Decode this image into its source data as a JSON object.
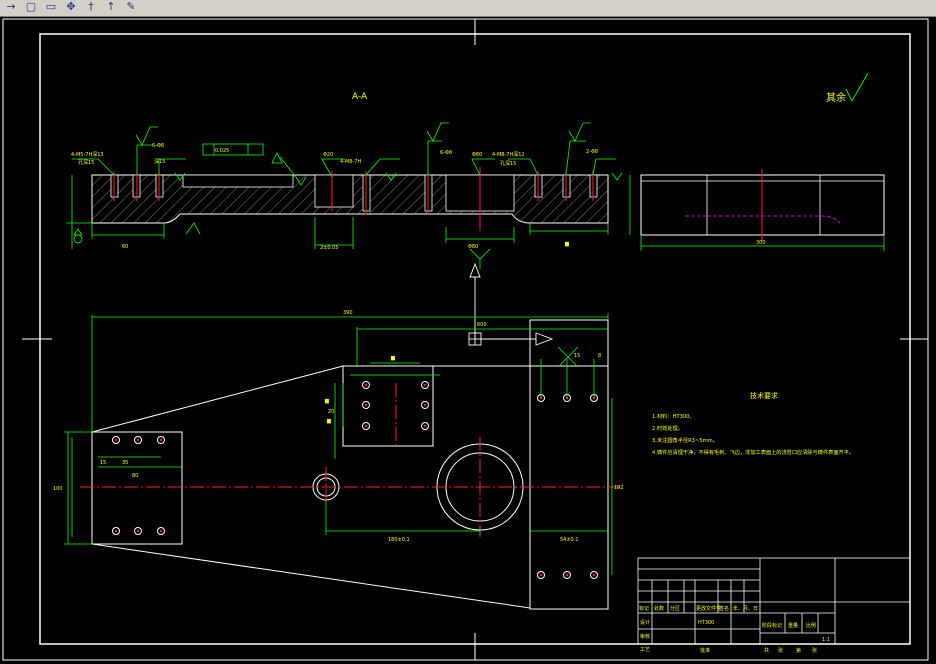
{
  "toolbar": {
    "tools": [
      {
        "name": "line-arrow-icon",
        "glyph": "→"
      },
      {
        "name": "rectangle-icon",
        "glyph": "▢"
      },
      {
        "name": "rectangle-alt-icon",
        "glyph": "▭"
      },
      {
        "name": "move-icon",
        "glyph": "✥"
      },
      {
        "name": "pin-icon",
        "glyph": "†"
      },
      {
        "name": "pointer-icon",
        "glyph": "↑"
      },
      {
        "name": "paint-icon",
        "glyph": "✎"
      }
    ]
  },
  "colors": {
    "background": "#000000",
    "frame": "#ffffff",
    "dimension": "#00ff00",
    "centerline": "#ff2020",
    "hatch": "#c0c0c0",
    "text_yellow": "#ffff00",
    "text_green": "#00ff00",
    "magenta": "#ff00ff"
  },
  "section": {
    "title": "A-A"
  },
  "surface": {
    "label": "其余"
  },
  "tech": {
    "title": "技术要求",
    "items": [
      "1.材料：HT300。",
      "2.时效处理。",
      "3.未注圆角半径R3~5mm。",
      "4.铸件应清理干净，不得有毛刺、飞边，非加工表面上的浇冒口应清除与铸件表面齐平。"
    ]
  },
  "dims": {
    "overall_width": "390",
    "upper_width": "600",
    "left_height": "100",
    "center_spacing": "180±0.1",
    "right_dim": "54±0.1",
    "right_vert": "182",
    "left_len": "60",
    "side_width": "300",
    "dim_15": "15",
    "dim_35": "35",
    "dim_80": "80",
    "dim_8": "8"
  },
  "title_block": {
    "headers": [
      "标记",
      "处数",
      "分区",
      "更改文件号",
      "签名",
      "年、月、日"
    ],
    "rows": [
      "设计",
      "审核",
      "工艺"
    ],
    "material": "HT300",
    "cols": [
      "阶段标记",
      "重量",
      "比例"
    ],
    "scale": "1:1",
    "sheet": [
      "共",
      "张",
      "第",
      "张"
    ],
    "approve": "批准"
  }
}
